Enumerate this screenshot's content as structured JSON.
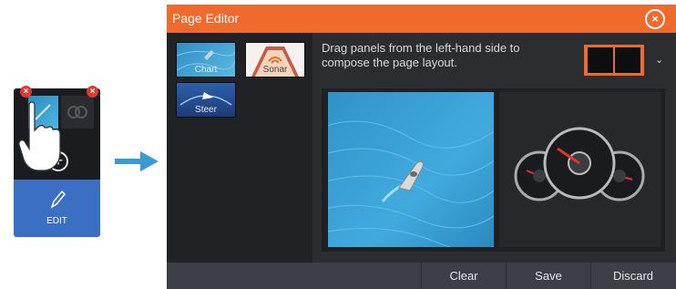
{
  "mini_tile": {
    "edit_label": "EDIT"
  },
  "dialog": {
    "title": "Page Editor",
    "panels": [
      {
        "label": "Chart"
      },
      {
        "label": "Sonar"
      },
      {
        "label": "Steer"
      }
    ],
    "instructions": "Drag panels from the left-hand side to compose the page layout.",
    "buttons": {
      "clear": "Clear",
      "save": "Save",
      "discard": "Discard"
    }
  },
  "colors": {
    "accent": "#ef6a2c",
    "edit_blue": "#3b6fc4",
    "chart_blue": "#3aa3d8",
    "close_red": "#e03a2e"
  },
  "icons": [
    "close-icon",
    "plus-icon",
    "pencil-icon",
    "hand-pointer-icon",
    "arrow-right-icon",
    "chevron-down-icon",
    "boat-icon",
    "gauge-icon"
  ]
}
